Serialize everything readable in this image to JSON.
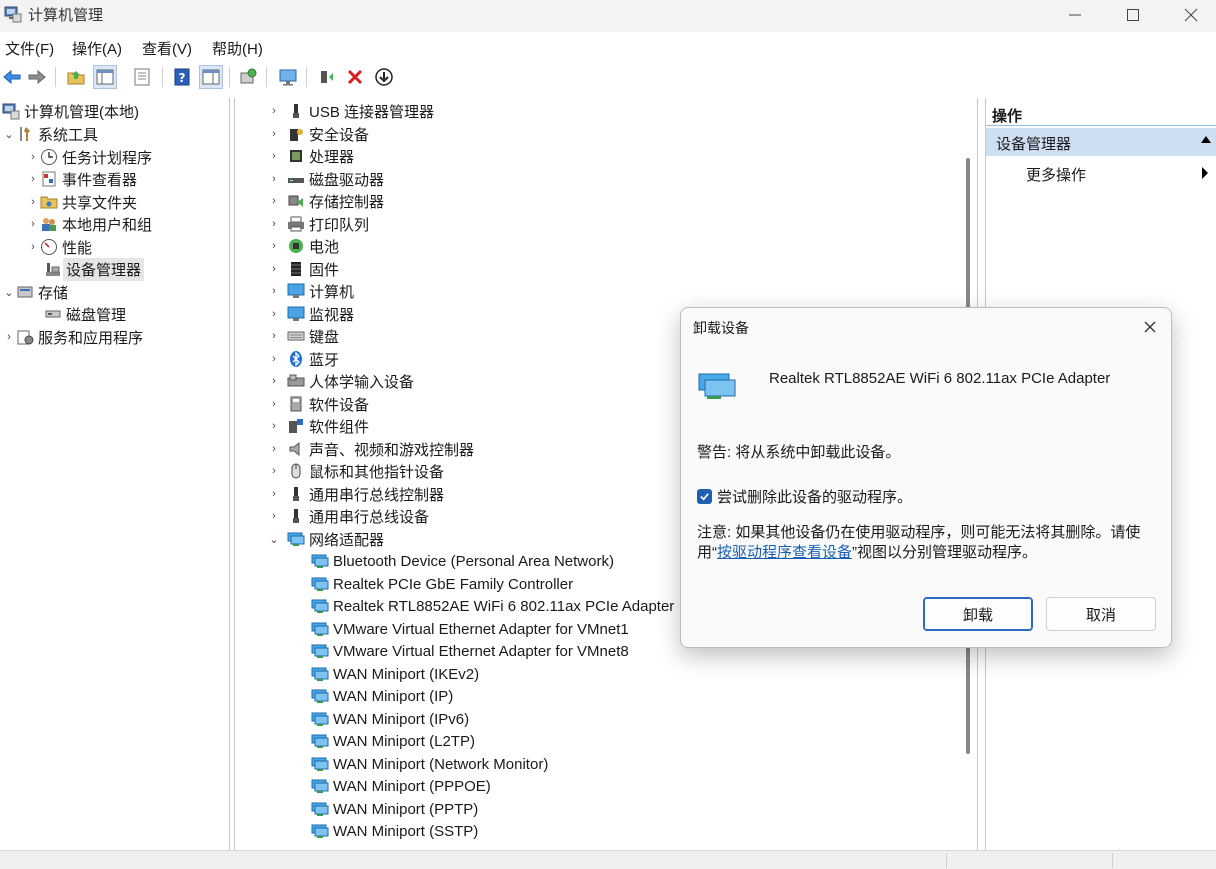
{
  "window": {
    "title": "计算机管理"
  },
  "menu": {
    "file": "文件(F)",
    "action": "操作(A)",
    "view": "查看(V)",
    "help": "帮助(H)"
  },
  "left_tree": {
    "root": "计算机管理(本地)",
    "system_tools": "系统工具",
    "task_scheduler": "任务计划程序",
    "event_viewer": "事件查看器",
    "shared_folders": "共享文件夹",
    "local_users": "本地用户和组",
    "performance": "性能",
    "device_manager": "设备管理器",
    "storage": "存储",
    "disk_management": "磁盘管理",
    "services": "服务和应用程序"
  },
  "device_categories": [
    "USB 连接器管理器",
    "安全设备",
    "处理器",
    "磁盘驱动器",
    "存储控制器",
    "打印队列",
    "电池",
    "固件",
    "计算机",
    "监视器",
    "键盘",
    "蓝牙",
    "人体学输入设备",
    "软件设备",
    "软件组件",
    "声音、视频和游戏控制器",
    "鼠标和其他指针设备",
    "通用串行总线控制器",
    "通用串行总线设备",
    "网络适配器"
  ],
  "network_adapters": [
    "Bluetooth Device (Personal Area Network)",
    "Realtek PCIe GbE Family Controller",
    "Realtek RTL8852AE WiFi 6 802.11ax PCIe Adapter",
    "VMware Virtual Ethernet Adapter for VMnet1",
    "VMware Virtual Ethernet Adapter for VMnet8",
    "WAN Miniport (IKEv2)",
    "WAN Miniport (IP)",
    "WAN Miniport (IPv6)",
    "WAN Miniport (L2TP)",
    "WAN Miniport (Network Monitor)",
    "WAN Miniport (PPPOE)",
    "WAN Miniport (PPTP)",
    "WAN Miniport (SSTP)"
  ],
  "actions": {
    "header": "操作",
    "section": "设备管理器",
    "more": "更多操作"
  },
  "dialog": {
    "title": "卸载设备",
    "device_name": "Realtek RTL8852AE WiFi 6 802.11ax PCIe Adapter",
    "warning": "警告: 将从系统中卸载此设备。",
    "checkbox_label": "尝试删除此设备的驱动程序。",
    "checkbox_checked": true,
    "note_prefix": "注意: 如果其他设备仍在使用驱动程序，则可能无法将其删除。请使用“",
    "note_link": "按驱动程序查看设备",
    "note_suffix": "”视图以分别管理驱动程序。",
    "uninstall": "卸载",
    "cancel": "取消"
  }
}
